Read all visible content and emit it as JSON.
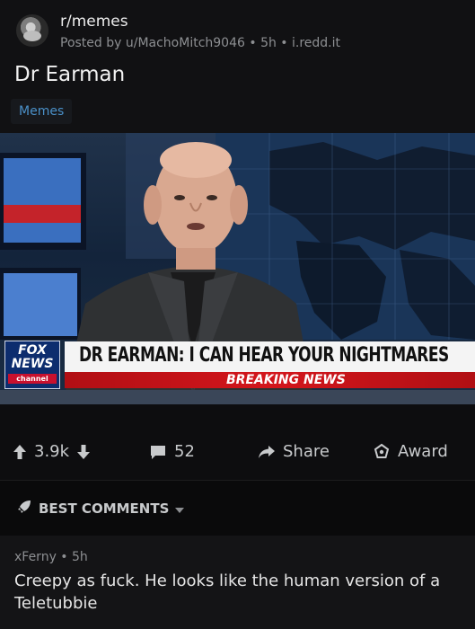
{
  "post": {
    "subreddit": "r/memes",
    "meta": "Posted by u/MachoMitch9046 • 5h • i.redd.it",
    "title": "Dr Earman",
    "flair": "Memes"
  },
  "image": {
    "channel_logo_line1": "FOX",
    "channel_logo_line2": "NEWS",
    "channel_logo_line3": "channel",
    "headline": "DR EARMAN: I CAN HEAR YOUR NIGHTMARES",
    "banner": "BREAKING NEWS"
  },
  "actions": {
    "score": "3.9k",
    "comments": "52",
    "share": "Share",
    "award": "Award"
  },
  "comments_section": {
    "sort_label": "BEST COMMENTS"
  },
  "comment": {
    "meta": "xFerny • 5h",
    "body": "Creepy as fuck. He looks like the human version of a Teletubbie"
  },
  "colors": {
    "background": "#0d0d0f",
    "flair_text": "#4a90c8",
    "breaking_red": "#c8102e"
  }
}
